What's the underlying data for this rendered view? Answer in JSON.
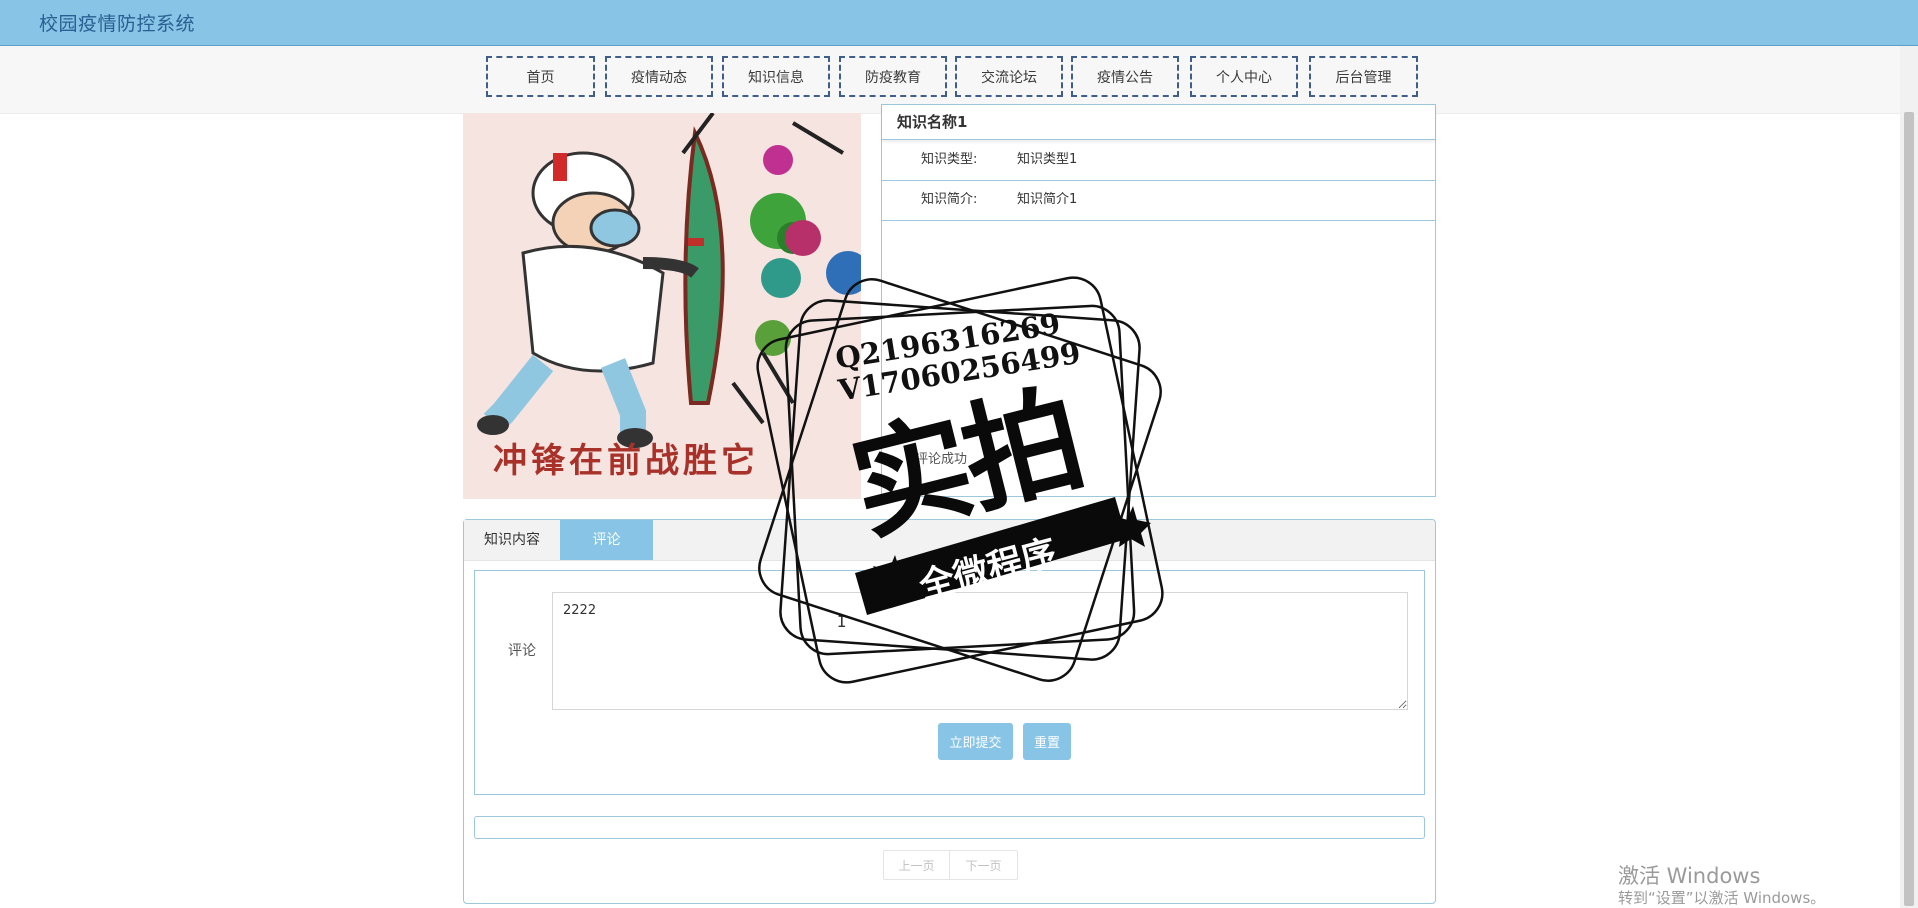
{
  "header": {
    "site_title": "校园疫情防控系统"
  },
  "nav": {
    "items": [
      {
        "label": "首页"
      },
      {
        "label": "疫情动态"
      },
      {
        "label": "知识信息"
      },
      {
        "label": "防疫教育"
      },
      {
        "label": "交流论坛"
      },
      {
        "label": "疫情公告"
      },
      {
        "label": "个人中心"
      },
      {
        "label": "后台管理"
      }
    ]
  },
  "hero": {
    "caption": "冲锋在前战胜它"
  },
  "detail": {
    "name": "知识名称1",
    "type_label": "知识类型:",
    "type_value": "知识类型1",
    "intro_label": "知识简介:",
    "intro_value": "知识简介1"
  },
  "toast": {
    "message": "评论成功"
  },
  "tabs": {
    "content_label": "知识内容",
    "comment_label": "评论",
    "active": "评论"
  },
  "comment_form": {
    "label": "评论",
    "value": "2222",
    "submit_label": "立即提交",
    "reset_label": "重置"
  },
  "pager": {
    "prev_label": "上一页",
    "next_label": "下一页"
  },
  "watermark": {
    "qq": "Q2196316269",
    "wx": "V17060256499",
    "big_text": "实拍",
    "ribbon_text": "全微程序"
  },
  "system_overlay": {
    "activate_title": "激活 Windows",
    "activate_sub": "转到“设置”以激活 Windows。"
  },
  "colors": {
    "header_bg": "#87c4e5",
    "accent": "#87c4e5",
    "title_text": "#2a5f93",
    "nav_border": "#3f5f8a",
    "panel_border": "#9cc7dd"
  }
}
